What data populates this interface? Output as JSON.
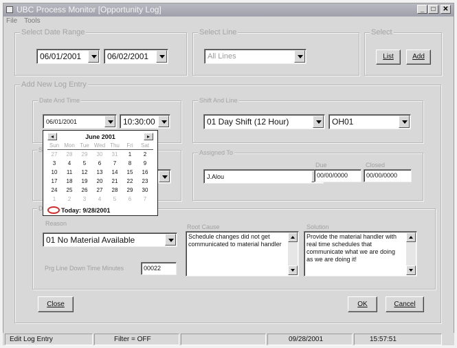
{
  "window": {
    "title": "UBC Process Monitor [Opportunity Log]"
  },
  "menu": [
    "File",
    "Tools"
  ],
  "select_date_range": {
    "title": "Select Date Range",
    "start": "06/01/2001",
    "end": "06/02/2001"
  },
  "select_line": {
    "title": "Select Line",
    "value": "All Lines"
  },
  "select": {
    "title": "Select",
    "list_label": "List",
    "add_label": "Add"
  },
  "add_new": {
    "title": "Add New Log Entry",
    "date_time": {
      "title": "Date And Time",
      "date": "06/01/2001",
      "time": "10:30:00"
    },
    "shift_line": {
      "title": "Shift And Line",
      "shift": "01 Day Shift (12 Hour)",
      "line": "OH01"
    },
    "status_group": {
      "title": "St"
    },
    "assigned": {
      "title": "Assigned To",
      "name": "J.Alou",
      "due_label": "Due",
      "due": "00/00/0000",
      "closed_label": "Closed",
      "closed": "00/00/0000"
    },
    "detail": {
      "title": "D",
      "reason_label": "Reason",
      "reason": "01 No Material Available",
      "downtime_label": "Prg Line Down Time Minutes",
      "downtime": "00022",
      "root_cause_label": "Root Cause",
      "root_cause": "Schedule changes did not get communicated to material handler",
      "solution_label": "Solution",
      "solution": "Provide the material handler with real time schedules that communicate what we are doing as we are doing it!"
    }
  },
  "calendar": {
    "title": "June 2001",
    "headers": [
      "Sun",
      "Mon",
      "Tue",
      "Wed",
      "Thu",
      "Fri",
      "Sat"
    ],
    "weeks": [
      [
        "27",
        "28",
        "29",
        "30",
        "31",
        "1",
        "2"
      ],
      [
        "3",
        "4",
        "5",
        "6",
        "7",
        "8",
        "9"
      ],
      [
        "10",
        "11",
        "12",
        "13",
        "14",
        "15",
        "16"
      ],
      [
        "17",
        "18",
        "19",
        "20",
        "21",
        "22",
        "23"
      ],
      [
        "24",
        "25",
        "26",
        "27",
        "28",
        "29",
        "30"
      ],
      [
        "1",
        "2",
        "3",
        "4",
        "5",
        "6",
        "7"
      ]
    ],
    "today": "Today: 9/28/2001"
  },
  "buttons": {
    "close": "Close",
    "ok": "OK",
    "cancel": "Cancel"
  },
  "status_bar": {
    "mode": "Edit Log Entry",
    "filter": "Filter = OFF",
    "blank": "",
    "date": "09/28/2001",
    "time": "15:57:51"
  },
  "colors": {
    "highlight_ring": "#d02a2a",
    "titlebar": "#a3a4ae"
  }
}
